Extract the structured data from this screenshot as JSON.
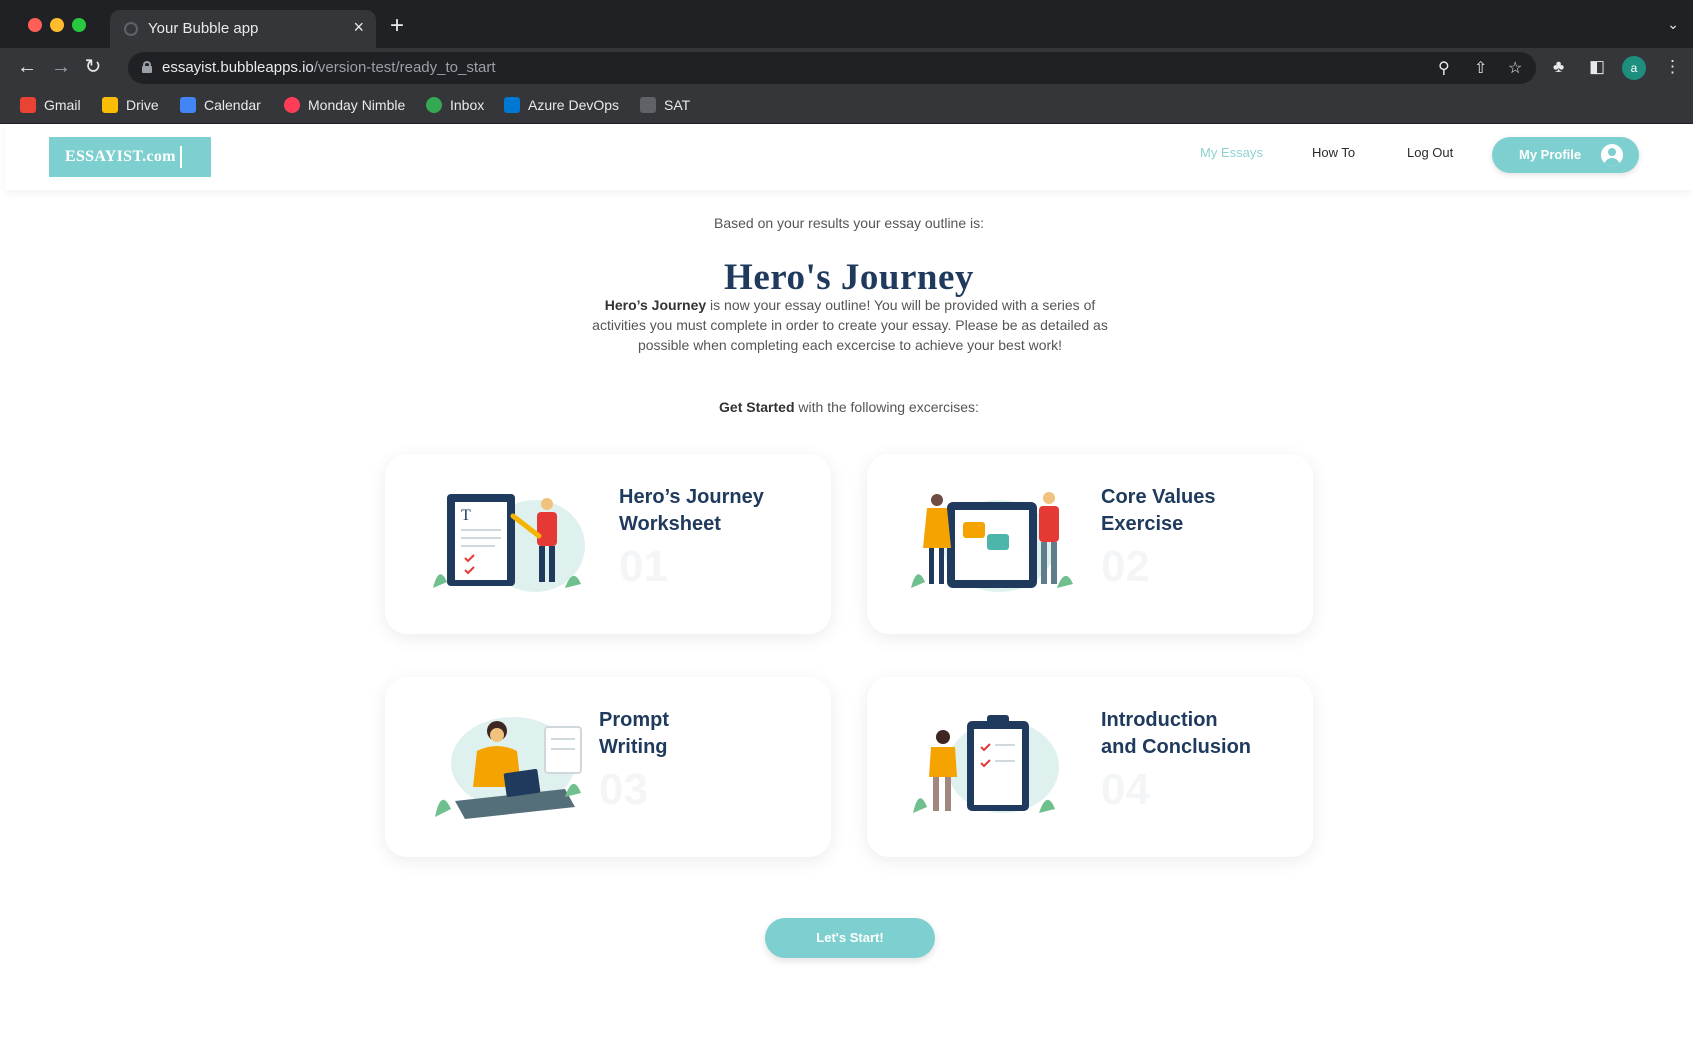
{
  "browser": {
    "tab_title": "Your Bubble app",
    "tab_close": "×",
    "new_tab": "+",
    "url_domain": "essayist.bubbleapps.io",
    "url_path": "/version-test/ready_to_start",
    "profile_initial": "a",
    "bookmarks": [
      {
        "label": "Gmail",
        "icon": "gmail-icon",
        "color": "#ea4335"
      },
      {
        "label": "Drive",
        "icon": "drive-icon",
        "color": "#fbbc04"
      },
      {
        "label": "Calendar",
        "icon": "calendar-icon",
        "color": "#4285f4"
      },
      {
        "label": "Monday Nimble",
        "icon": "monday-icon",
        "color": "#ff3d57"
      },
      {
        "label": "Inbox",
        "icon": "inbox-icon",
        "color": "#34a853"
      },
      {
        "label": "Azure DevOps",
        "icon": "azure-devops-icon",
        "color": "#0078d4"
      },
      {
        "label": "SAT",
        "icon": "sat-icon",
        "color": "#5f6368"
      }
    ]
  },
  "header": {
    "logo": "ESSAYIST.com",
    "nav": {
      "my_essays": "My Essays",
      "how_to": "How To",
      "log_out": "Log Out"
    },
    "profile_button": "My Profile"
  },
  "main": {
    "intro": "Based on your results your essay outline is:",
    "title": "Hero's Journey",
    "paragraph_bold": "Hero’s Journey",
    "paragraph_rest": " is now your essay outline! You will be provided with a series of activities you must complete in order to create your essay. Please be as detailed as possible when completing each excercise to achieve your best work!",
    "get_started_bold": "Get Started",
    "get_started_rest": " with the following excercises:",
    "exercises": [
      {
        "line1": "Hero’s Journey",
        "line2": "Worksheet",
        "number": "01"
      },
      {
        "line1": "Core Values",
        "line2": "Exercise",
        "number": "02"
      },
      {
        "line1": "Prompt",
        "line2": "Writing",
        "number": "03"
      },
      {
        "line1": "Introduction",
        "line2": "and Conclusion",
        "number": "04"
      }
    ],
    "start_button": "Let's Start!"
  },
  "colors": {
    "accent": "#7ecfcf",
    "title": "#1f3a5c",
    "nav_active": "#8fd2d2"
  }
}
